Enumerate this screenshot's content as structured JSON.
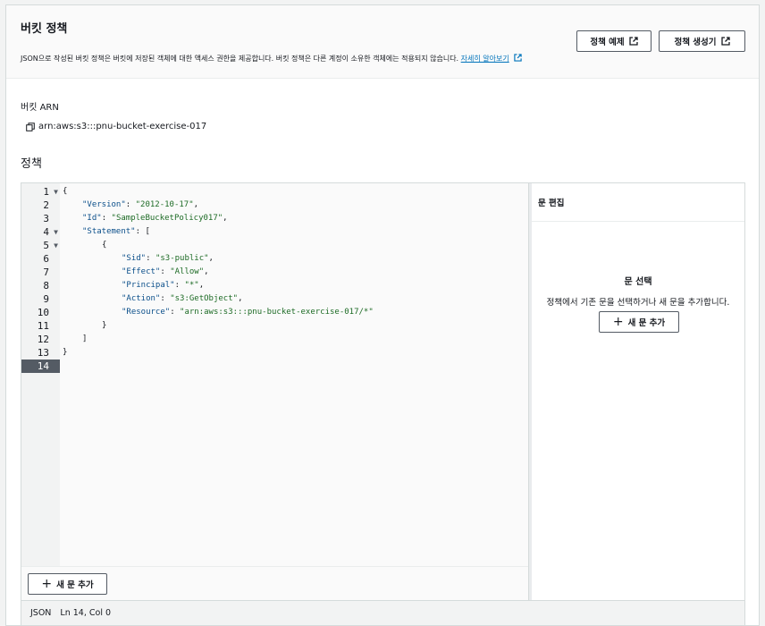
{
  "header": {
    "title": "버킷 정책",
    "description": "JSON으로 작성된 버킷 정책은 버킷에 저장된 객체에 대한 액세스 권한을 제공합니다. 버킷 정책은 다른 계정이 소유한 객체에는 적용되지 않습니다.",
    "learn_more": "자세히 알아보기",
    "btn_example": "정책 예제",
    "btn_generator": "정책 생성기"
  },
  "arn": {
    "label": "버킷 ARN",
    "value": "arn:aws:s3:::pnu-bucket-exercise-017"
  },
  "policy": {
    "label": "정책"
  },
  "editor": {
    "lines": [
      {
        "n": "1",
        "fold": "▼",
        "indent": 0,
        "parts": [
          {
            "t": "p",
            "v": "{"
          }
        ]
      },
      {
        "n": "2",
        "fold": "",
        "indent": 1,
        "parts": [
          {
            "t": "k",
            "v": "\"Version\""
          },
          {
            "t": "p",
            "v": ": "
          },
          {
            "t": "s",
            "v": "\"2012-10-17\""
          },
          {
            "t": "p",
            "v": ","
          }
        ]
      },
      {
        "n": "3",
        "fold": "",
        "indent": 1,
        "parts": [
          {
            "t": "k",
            "v": "\"Id\""
          },
          {
            "t": "p",
            "v": ": "
          },
          {
            "t": "s",
            "v": "\"SampleBucketPolicy017\""
          },
          {
            "t": "p",
            "v": ","
          }
        ]
      },
      {
        "n": "4",
        "fold": "▼",
        "indent": 1,
        "parts": [
          {
            "t": "k",
            "v": "\"Statement\""
          },
          {
            "t": "p",
            "v": ": ["
          }
        ]
      },
      {
        "n": "5",
        "fold": "▼",
        "indent": 2,
        "parts": [
          {
            "t": "p",
            "v": "{"
          }
        ]
      },
      {
        "n": "6",
        "fold": "",
        "indent": 3,
        "parts": [
          {
            "t": "k",
            "v": "\"Sid\""
          },
          {
            "t": "p",
            "v": ": "
          },
          {
            "t": "s",
            "v": "\"s3-public\""
          },
          {
            "t": "p",
            "v": ","
          }
        ]
      },
      {
        "n": "7",
        "fold": "",
        "indent": 3,
        "parts": [
          {
            "t": "k",
            "v": "\"Effect\""
          },
          {
            "t": "p",
            "v": ": "
          },
          {
            "t": "s",
            "v": "\"Allow\""
          },
          {
            "t": "p",
            "v": ","
          }
        ]
      },
      {
        "n": "8",
        "fold": "",
        "indent": 3,
        "parts": [
          {
            "t": "k",
            "v": "\"Principal\""
          },
          {
            "t": "p",
            "v": ": "
          },
          {
            "t": "s",
            "v": "\"*\""
          },
          {
            "t": "p",
            "v": ","
          }
        ]
      },
      {
        "n": "9",
        "fold": "",
        "indent": 3,
        "parts": [
          {
            "t": "k",
            "v": "\"Action\""
          },
          {
            "t": "p",
            "v": ": "
          },
          {
            "t": "s",
            "v": "\"s3:GetObject\""
          },
          {
            "t": "p",
            "v": ","
          }
        ]
      },
      {
        "n": "10",
        "fold": "",
        "indent": 3,
        "parts": [
          {
            "t": "k",
            "v": "\"Resource\""
          },
          {
            "t": "p",
            "v": ": "
          },
          {
            "t": "s",
            "v": "\"arn:aws:s3:::pnu-bucket-exercise-017/*\""
          }
        ]
      },
      {
        "n": "11",
        "fold": "",
        "indent": 2,
        "parts": [
          {
            "t": "p",
            "v": "}"
          }
        ]
      },
      {
        "n": "12",
        "fold": "",
        "indent": 1,
        "parts": [
          {
            "t": "p",
            "v": "]"
          }
        ]
      },
      {
        "n": "13",
        "fold": "",
        "indent": 0,
        "parts": [
          {
            "t": "p",
            "v": "}"
          }
        ]
      },
      {
        "n": "14",
        "fold": "",
        "indent": 0,
        "parts": []
      }
    ],
    "active_line": "14",
    "add_statement": "새 문 추가"
  },
  "side": {
    "header": "문 편집",
    "title": "문 선택",
    "description": "정책에서 기존 문을 선택하거나 새 문을 추가합니다.",
    "add_statement": "새 문 추가"
  },
  "status": {
    "language": "JSON",
    "position": "Ln 14, Col 0"
  },
  "colors": {
    "key": "#0b4f8a",
    "string": "#1d6b25",
    "link": "#0073bb",
    "active_line": "#545b64"
  }
}
